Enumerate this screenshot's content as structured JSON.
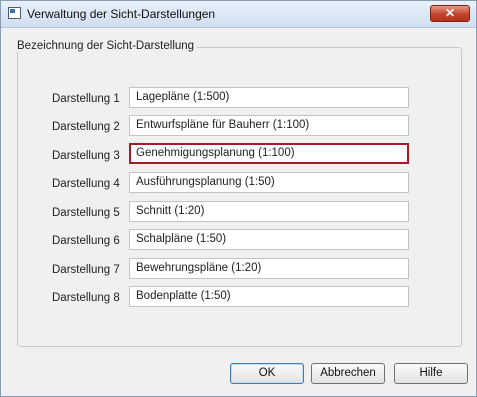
{
  "window": {
    "title": "Verwaltung der Sicht-Darstellungen",
    "close_label": "✕"
  },
  "group": {
    "label": "Bezeichnung der Sicht-Darstellung"
  },
  "rows": [
    {
      "label": "Darstellung 1",
      "value": "Lagepläne (1:500)",
      "selected": false
    },
    {
      "label": "Darstellung 2",
      "value": "Entwurfspläne für Bauherr (1:100)",
      "selected": false
    },
    {
      "label": "Darstellung 3",
      "value": "Genehmigungsplanung (1:100)",
      "selected": true
    },
    {
      "label": "Darstellung 4",
      "value": "Ausführungsplanung (1:50)",
      "selected": false
    },
    {
      "label": "Darstellung 5",
      "value": "Schnitt (1:20)",
      "selected": false
    },
    {
      "label": "Darstellung 6",
      "value": "Schalpläne (1:50)",
      "selected": false
    },
    {
      "label": "Darstellung 7",
      "value": "Bewehrungspläne (1:20)",
      "selected": false
    },
    {
      "label": "Darstellung 8",
      "value": "Bodenplatte (1:50)",
      "selected": false
    }
  ],
  "buttons": {
    "ok": "OK",
    "cancel": "Abbrechen",
    "help": "Hilfe"
  },
  "colors": {
    "selected_border": "#a51b21",
    "close_button": "#c2432a"
  }
}
